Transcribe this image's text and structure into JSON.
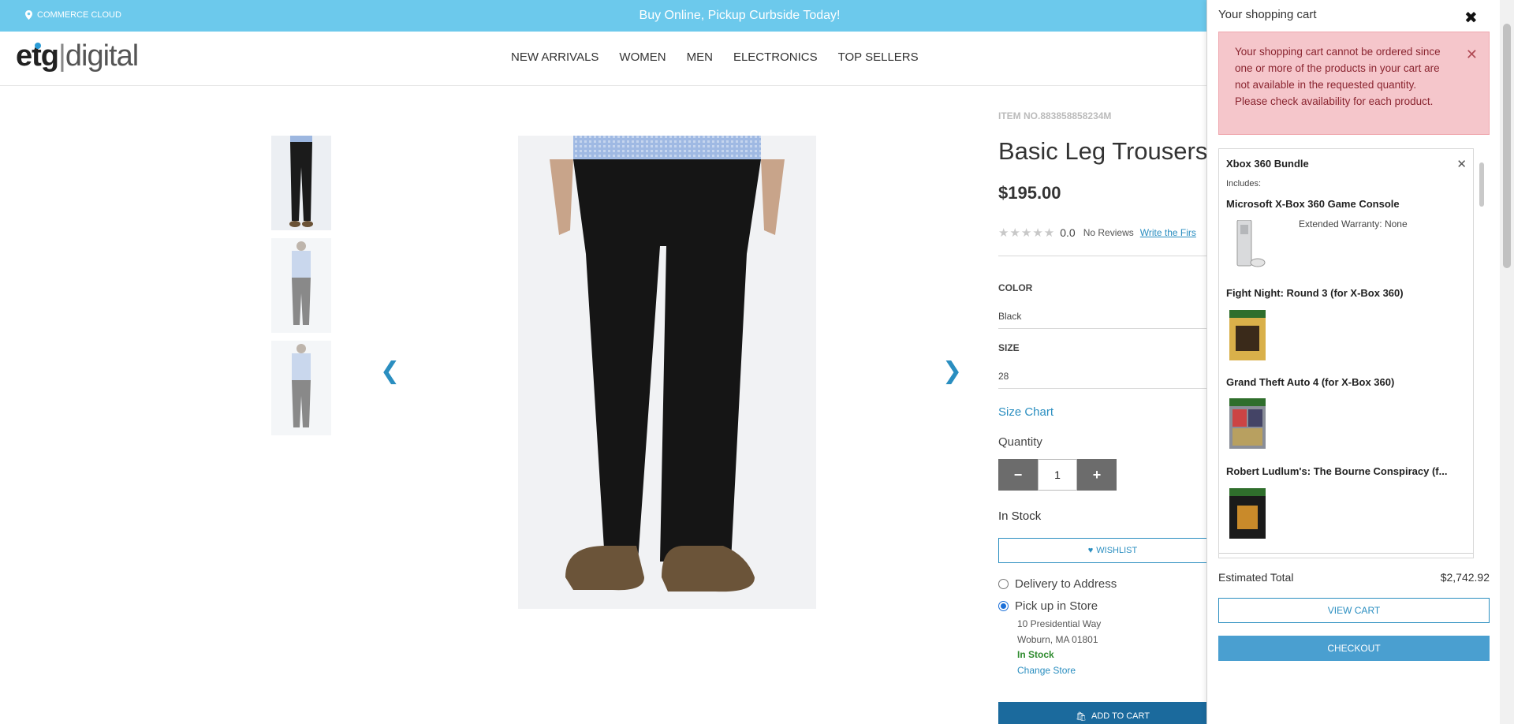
{
  "promo": {
    "store_label": "COMMERCE CLOUD",
    "message": "Buy Online, Pickup Curbside Today!"
  },
  "logo": {
    "part1": "etg",
    "part2": "digital"
  },
  "nav": [
    "NEW ARRIVALS",
    "WOMEN",
    "MEN",
    "ELECTRONICS",
    "TOP SELLERS"
  ],
  "product": {
    "item_no": "ITEM NO.883858858234M",
    "title": "Basic Leg Trousers",
    "price": "$195.00",
    "rating_value": "0.0",
    "reviews_label": "No Reviews",
    "write_review": "Write the Firs",
    "color_label": "COLOR",
    "color_value": "Black",
    "size_label": "SIZE",
    "size_value": "28",
    "size_chart": "Size Chart",
    "quantity_label": "Quantity",
    "quantity_value": "1",
    "availability": "In Stock",
    "wishlist": "WISHLIST",
    "delivery_option": "Delivery to Address",
    "pickup_option": "Pick up in Store",
    "store_address1": "10 Presidential Way",
    "store_address2": "Woburn, MA 01801",
    "store_stock": "In Stock",
    "change_store": "Change Store",
    "add_to_cart": "ADD TO CART",
    "selected_fulfillment": "pickup"
  },
  "cart": {
    "title": "Your shopping cart",
    "alert": "Your shopping cart cannot be ordered since one or more of the products in your cart are not available in the requested quantity. Please check availability for each product.",
    "bundle_name": "Xbox 360 Bundle",
    "includes_label": "Includes:",
    "items": [
      {
        "name": "Microsoft X-Box 360 Game Console",
        "extra": "Extended Warranty: None",
        "icon": "console-image"
      },
      {
        "name": "Fight Night: Round 3 (for X-Box 360)",
        "icon": "game-cover-image"
      },
      {
        "name": "Grand Theft Auto 4 (for X-Box 360)",
        "icon": "game-cover-image"
      },
      {
        "name": "Robert Ludlum's: The Bourne Conspiracy (f...",
        "icon": "game-cover-image"
      }
    ],
    "estimated_total_label": "Estimated Total",
    "estimated_total_value": "$2,742.92",
    "view_cart": "VIEW CART",
    "checkout": "CHECKOUT"
  },
  "colors": {
    "promo_bg": "#6cc9ec",
    "link": "#2a8ec0",
    "alert_bg": "#f5c6cb",
    "add_to_cart_bg": "#1b6a9d",
    "checkout_bg": "#4a9fd0"
  }
}
